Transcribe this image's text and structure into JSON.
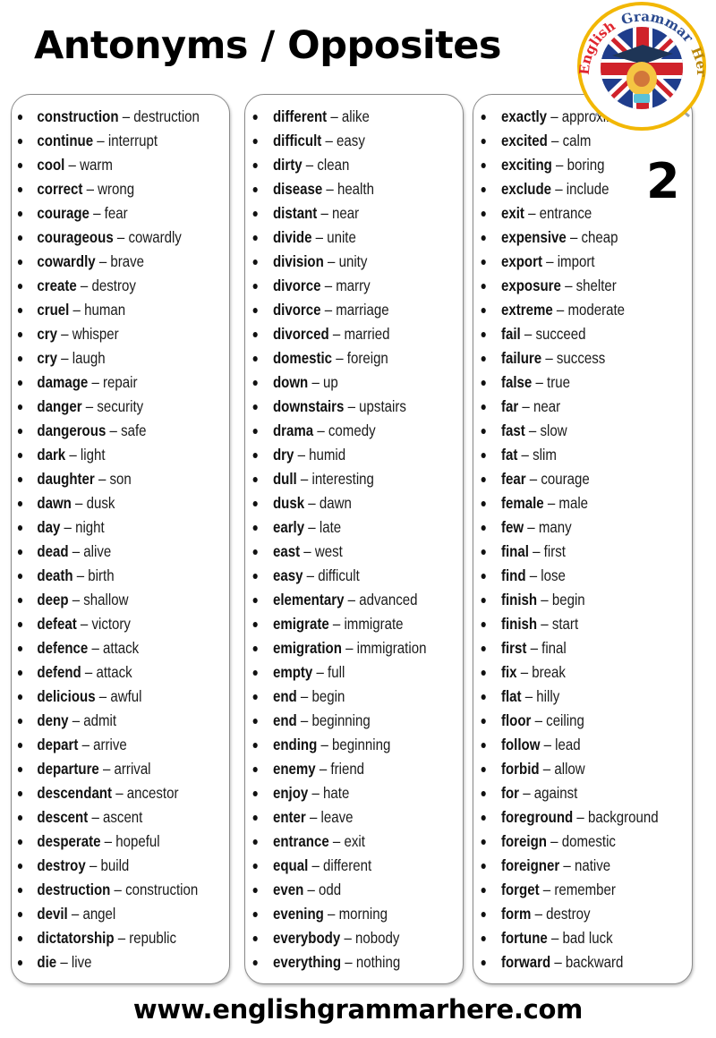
{
  "header": {
    "title": "Antonyms / Opposites",
    "page_number": "2"
  },
  "logo": {
    "word1": "English",
    "word2": "Grammar",
    "word3": "Here",
    "word4": ".Com",
    "colors": {
      "ring": "#f2b705",
      "english": "#e0262f",
      "grammar": "#2b4a8f",
      "here": "#b8860b",
      "com": "#1a3366"
    }
  },
  "columns": [
    {
      "items": [
        {
          "word": "construction",
          "opposite": "destruction"
        },
        {
          "word": "continue",
          "opposite": "interrupt"
        },
        {
          "word": "cool",
          "opposite": "warm"
        },
        {
          "word": "correct",
          "opposite": "wrong"
        },
        {
          "word": "courage",
          "opposite": "fear"
        },
        {
          "word": "courageous",
          "opposite": "cowardly"
        },
        {
          "word": "cowardly",
          "opposite": "brave"
        },
        {
          "word": "create",
          "opposite": "destroy"
        },
        {
          "word": "cruel",
          "opposite": "human"
        },
        {
          "word": "cry",
          "opposite": "whisper"
        },
        {
          "word": "cry",
          "opposite": "laugh"
        },
        {
          "word": "damage",
          "opposite": "repair"
        },
        {
          "word": "danger",
          "opposite": "security"
        },
        {
          "word": "dangerous",
          "opposite": "safe"
        },
        {
          "word": "dark",
          "opposite": "light"
        },
        {
          "word": "daughter",
          "opposite": "son"
        },
        {
          "word": "dawn",
          "opposite": "dusk"
        },
        {
          "word": "day",
          "opposite": "night"
        },
        {
          "word": "dead",
          "opposite": "alive"
        },
        {
          "word": "death",
          "opposite": "birth"
        },
        {
          "word": "deep",
          "opposite": "shallow"
        },
        {
          "word": "defeat",
          "opposite": "victory"
        },
        {
          "word": "defence",
          "opposite": "attack"
        },
        {
          "word": "defend",
          "opposite": "attack"
        },
        {
          "word": "delicious",
          "opposite": "awful"
        },
        {
          "word": "deny",
          "opposite": "admit"
        },
        {
          "word": "depart",
          "opposite": "arrive"
        },
        {
          "word": "departure",
          "opposite": "arrival"
        },
        {
          "word": "descendant",
          "opposite": "ancestor"
        },
        {
          "word": "descent",
          "opposite": "ascent"
        },
        {
          "word": "desperate",
          "opposite": "hopeful"
        },
        {
          "word": "destroy",
          "opposite": "build"
        },
        {
          "word": "destruction",
          "opposite": "construction"
        },
        {
          "word": "devil",
          "opposite": "angel"
        },
        {
          "word": "dictatorship",
          "opposite": "republic"
        },
        {
          "word": "die",
          "opposite": "live"
        }
      ]
    },
    {
      "items": [
        {
          "word": "different",
          "opposite": "alike"
        },
        {
          "word": "difficult",
          "opposite": "easy"
        },
        {
          "word": "dirty",
          "opposite": "clean"
        },
        {
          "word": "disease",
          "opposite": "health"
        },
        {
          "word": "distant",
          "opposite": "near"
        },
        {
          "word": "divide",
          "opposite": "unite"
        },
        {
          "word": "division",
          "opposite": "unity"
        },
        {
          "word": "divorce",
          "opposite": "marry"
        },
        {
          "word": "divorce",
          "opposite": "marriage"
        },
        {
          "word": "divorced",
          "opposite": "married"
        },
        {
          "word": "domestic",
          "opposite": "foreign"
        },
        {
          "word": "down",
          "opposite": "up"
        },
        {
          "word": "downstairs",
          "opposite": "upstairs"
        },
        {
          "word": "drama",
          "opposite": "comedy"
        },
        {
          "word": "dry",
          "opposite": "humid"
        },
        {
          "word": "dull",
          "opposite": "interesting"
        },
        {
          "word": "dusk",
          "opposite": "dawn"
        },
        {
          "word": "early",
          "opposite": "late"
        },
        {
          "word": "east",
          "opposite": "west"
        },
        {
          "word": "easy",
          "opposite": "difficult"
        },
        {
          "word": "elementary",
          "opposite": "advanced"
        },
        {
          "word": "emigrate",
          "opposite": "immigrate"
        },
        {
          "word": "emigration",
          "opposite": "immigration"
        },
        {
          "word": "empty",
          "opposite": "full"
        },
        {
          "word": "end",
          "opposite": "begin"
        },
        {
          "word": "end",
          "opposite": "beginning"
        },
        {
          "word": "ending",
          "opposite": "beginning"
        },
        {
          "word": "enemy",
          "opposite": "friend"
        },
        {
          "word": "enjoy",
          "opposite": "hate"
        },
        {
          "word": "enter",
          "opposite": "leave"
        },
        {
          "word": "entrance",
          "opposite": "exit"
        },
        {
          "word": "equal",
          "opposite": "different"
        },
        {
          "word": "even",
          "opposite": "odd"
        },
        {
          "word": "evening",
          "opposite": "morning"
        },
        {
          "word": "everybody",
          "opposite": "nobody"
        },
        {
          "word": "everything",
          "opposite": "nothing"
        }
      ]
    },
    {
      "items": [
        {
          "word": "exactly",
          "opposite": "approximately"
        },
        {
          "word": "excited",
          "opposite": "calm"
        },
        {
          "word": "exciting",
          "opposite": "boring"
        },
        {
          "word": "exclude",
          "opposite": "include"
        },
        {
          "word": "exit",
          "opposite": "entrance"
        },
        {
          "word": "expensive",
          "opposite": "cheap"
        },
        {
          "word": "export",
          "opposite": "import"
        },
        {
          "word": "exposure",
          "opposite": "shelter"
        },
        {
          "word": "extreme",
          "opposite": "moderate"
        },
        {
          "word": "fail",
          "opposite": "succeed"
        },
        {
          "word": "failure",
          "opposite": "success"
        },
        {
          "word": "false",
          "opposite": "true"
        },
        {
          "word": "far",
          "opposite": "near"
        },
        {
          "word": "fast",
          "opposite": "slow"
        },
        {
          "word": "fat",
          "opposite": "slim"
        },
        {
          "word": "fear",
          "opposite": "courage"
        },
        {
          "word": "female",
          "opposite": "male"
        },
        {
          "word": "few",
          "opposite": "many"
        },
        {
          "word": "final",
          "opposite": "first"
        },
        {
          "word": "find",
          "opposite": "lose"
        },
        {
          "word": "finish",
          "opposite": "begin"
        },
        {
          "word": "finish",
          "opposite": "start"
        },
        {
          "word": "first",
          "opposite": "final"
        },
        {
          "word": "fix",
          "opposite": "break"
        },
        {
          "word": "flat",
          "opposite": "hilly"
        },
        {
          "word": "floor",
          "opposite": "ceiling"
        },
        {
          "word": "follow",
          "opposite": "lead"
        },
        {
          "word": "forbid",
          "opposite": "allow"
        },
        {
          "word": "for",
          "opposite": "against"
        },
        {
          "word": "foreground",
          "opposite": "background"
        },
        {
          "word": "foreign",
          "opposite": "domestic"
        },
        {
          "word": "foreigner",
          "opposite": "native"
        },
        {
          "word": "forget",
          "opposite": "remember"
        },
        {
          "word": "form",
          "opposite": "destroy"
        },
        {
          "word": "fortune",
          "opposite": "bad luck"
        },
        {
          "word": "forward",
          "opposite": "backward"
        }
      ]
    }
  ],
  "separator": "–",
  "footer": {
    "url": "www.englishgrammarhere.com"
  }
}
